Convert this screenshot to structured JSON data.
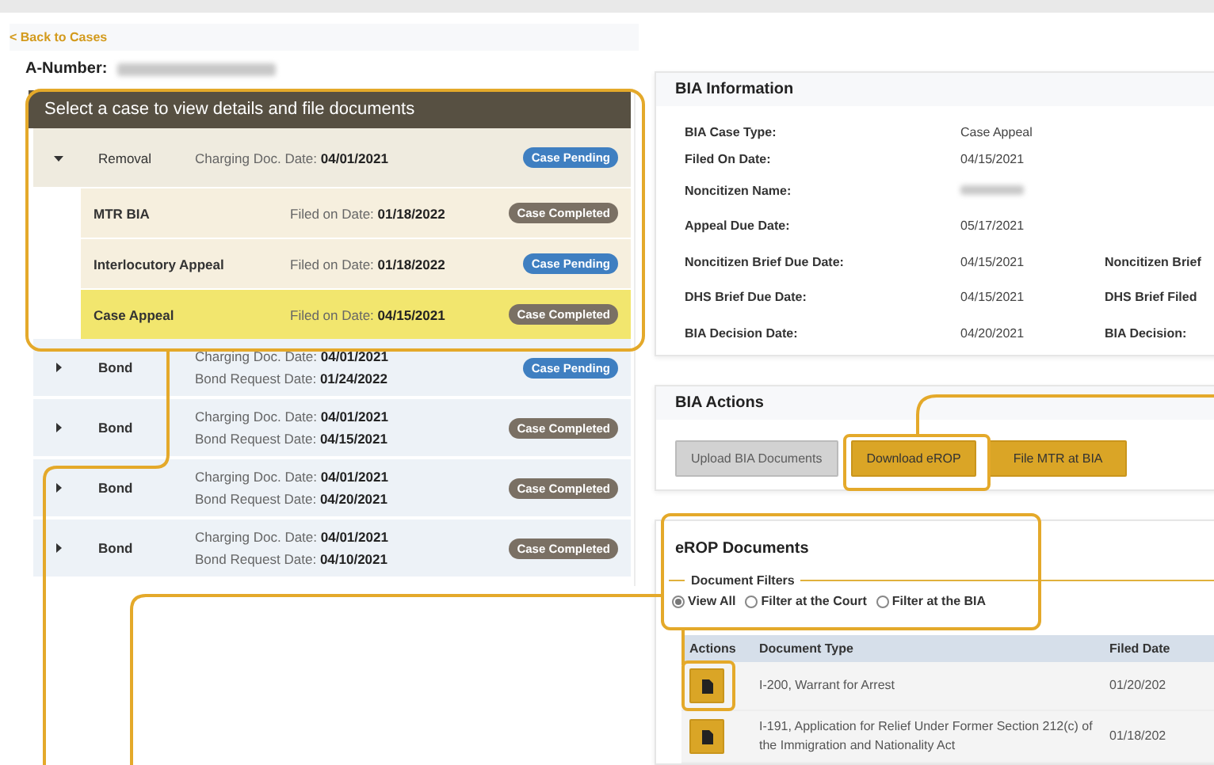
{
  "back_link": "< Back to Cases",
  "a_number": {
    "label": "A-Number:",
    "redacted": true
  },
  "case_list": {
    "title": "Select a case to view details and file documents",
    "cases": [
      {
        "type": "Removal",
        "expanded": true,
        "dates": [
          {
            "label": "Charging Doc. Date:",
            "value": "04/01/2021"
          }
        ],
        "status": {
          "text": "Case Pending",
          "kind": "pending"
        },
        "children": [
          {
            "type": "MTR BIA",
            "selected": false,
            "date": {
              "label": "Filed on Date:",
              "value": "01/18/2022"
            },
            "status": {
              "text": "Case Completed",
              "kind": "completed"
            }
          },
          {
            "type": "Interlocutory Appeal",
            "selected": false,
            "date": {
              "label": "Filed on Date:",
              "value": "01/18/2022"
            },
            "status": {
              "text": "Case Pending",
              "kind": "pending"
            }
          },
          {
            "type": "Case Appeal",
            "selected": true,
            "date": {
              "label": "Filed on Date:",
              "value": "04/15/2021"
            },
            "status": {
              "text": "Case Completed",
              "kind": "completed"
            }
          }
        ]
      },
      {
        "type": "Bond",
        "expanded": false,
        "dates": [
          {
            "label": "Charging Doc. Date:",
            "value": "04/01/2021"
          },
          {
            "label": "Bond Request Date:",
            "value": "01/24/2022"
          }
        ],
        "status": {
          "text": "Case Pending",
          "kind": "pending"
        }
      },
      {
        "type": "Bond",
        "expanded": false,
        "dates": [
          {
            "label": "Charging Doc. Date:",
            "value": "04/01/2021"
          },
          {
            "label": "Bond Request Date:",
            "value": "04/15/2021"
          }
        ],
        "status": {
          "text": "Case Completed",
          "kind": "completed"
        }
      },
      {
        "type": "Bond",
        "expanded": false,
        "dates": [
          {
            "label": "Charging Doc. Date:",
            "value": "04/01/2021"
          },
          {
            "label": "Bond Request Date:",
            "value": "04/20/2021"
          }
        ],
        "status": {
          "text": "Case Completed",
          "kind": "completed"
        }
      },
      {
        "type": "Bond",
        "expanded": false,
        "dates": [
          {
            "label": "Charging Doc. Date:",
            "value": "04/01/2021"
          },
          {
            "label": "Bond Request Date:",
            "value": "04/10/2021"
          }
        ],
        "status": {
          "text": "Case Completed",
          "kind": "completed"
        }
      }
    ]
  },
  "bia_information": {
    "title": "BIA Information",
    "rows": [
      {
        "label": "BIA Case Type:",
        "value": "Case Appeal"
      },
      {
        "label": "Filed On Date:",
        "value": "04/15/2021"
      },
      {
        "label": "Noncitizen Name:",
        "redacted": true
      },
      {
        "label": "Appeal Due Date:",
        "value": "05/17/2021"
      },
      {
        "label": "Noncitizen Brief Due Date:",
        "value": "04/15/2021",
        "label_2": "Noncitizen Brief"
      },
      {
        "label": "DHS Brief Due Date:",
        "value": "04/15/2021",
        "label_2": "DHS Brief Filed"
      },
      {
        "label": "BIA Decision Date:",
        "value": "04/20/2021",
        "label_2": "BIA Decision:"
      }
    ]
  },
  "bia_actions": {
    "title": "BIA Actions",
    "buttons": [
      {
        "label": "Upload BIA Documents",
        "disabled": true
      },
      {
        "label": "Download eROP",
        "disabled": false
      },
      {
        "label": "File MTR at BIA",
        "disabled": false
      }
    ]
  },
  "erop_documents": {
    "title": "eROP Documents",
    "filters": {
      "legend": "Document Filters",
      "options": [
        {
          "label": "View All",
          "selected": true
        },
        {
          "label": "Filter at the Court",
          "selected": false
        },
        {
          "label": "Filter at the BIA",
          "selected": false
        }
      ]
    },
    "table": {
      "columns": [
        "Actions",
        "Document Type",
        "Filed Date"
      ],
      "rows": [
        {
          "document_type": "I-200, Warrant for Arrest",
          "filed_date": "01/20/202"
        },
        {
          "document_type": "I-191, Application for Relief Under Former Section 212(c) of the Immigration and Nationality Act",
          "filed_date": "01/18/202"
        }
      ]
    }
  }
}
